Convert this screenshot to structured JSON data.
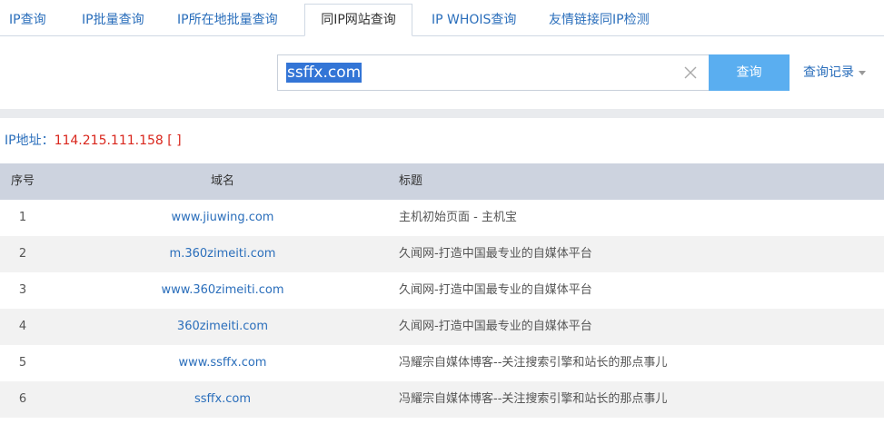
{
  "tabs": [
    {
      "label": "IP查询"
    },
    {
      "label": "IP批量查询"
    },
    {
      "label": "IP所在地批量查询"
    },
    {
      "label": "同IP网站查询",
      "active": true
    },
    {
      "label": "IP WHOIS查询"
    },
    {
      "label": "友情链接同IP检测"
    }
  ],
  "search": {
    "value": "ssffx.com",
    "button_label": "查询",
    "clear_icon": "close-icon",
    "history_label": "查询记录",
    "history_icon": "caret-down-icon"
  },
  "ip_info": {
    "label": "IP地址：",
    "value": "114.215.111.158 [ ]"
  },
  "table": {
    "headers": [
      "序号",
      "域名",
      "标题"
    ],
    "rows": [
      {
        "index": "1",
        "domain": "www.jiuwing.com",
        "title": "主机初始页面 - 主机宝"
      },
      {
        "index": "2",
        "domain": "m.360zimeiti.com",
        "title": "久闻网-打造中国最专业的自媒体平台"
      },
      {
        "index": "3",
        "domain": "www.360zimeiti.com",
        "title": "久闻网-打造中国最专业的自媒体平台"
      },
      {
        "index": "4",
        "domain": "360zimeiti.com",
        "title": "久闻网-打造中国最专业的自媒体平台"
      },
      {
        "index": "5",
        "domain": "www.ssffx.com",
        "title": "冯耀宗自媒体博客--关注搜索引擎和站长的那点事儿"
      },
      {
        "index": "6",
        "domain": "ssffx.com",
        "title": "冯耀宗自媒体博客--关注搜索引擎和站长的那点事儿"
      }
    ]
  },
  "colors": {
    "link": "#2a6ebb",
    "ip_value": "#d9261c",
    "search_button": "#5aaef0",
    "table_header": "#cdd3df",
    "row_alt": "#f2f2f2"
  }
}
